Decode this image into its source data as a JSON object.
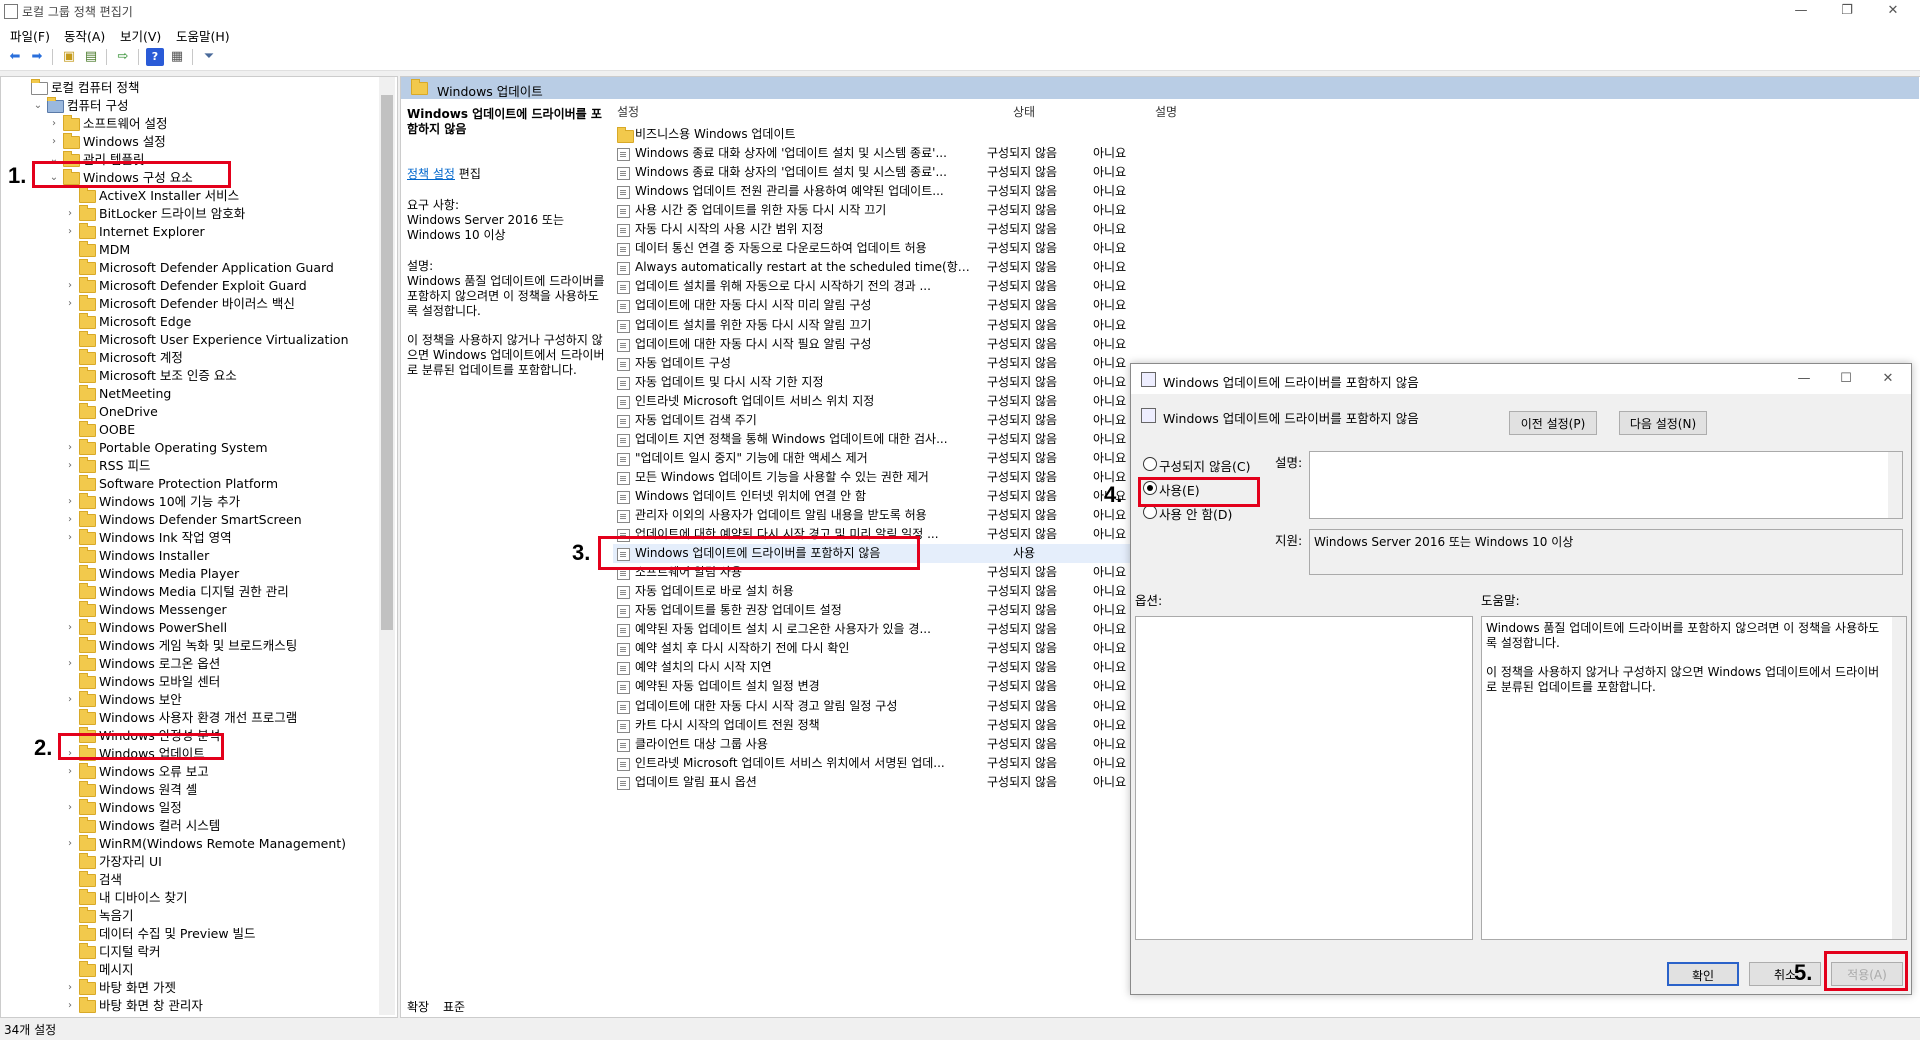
{
  "window": {
    "title": "로컬 그룹 정책 편집기"
  },
  "menu": [
    "파일(F)",
    "동작(A)",
    "보기(V)",
    "도움말(H)"
  ],
  "tree": {
    "items": [
      {
        "label": "로컬 컴퓨터 정책"
      },
      {
        "label": "컴퓨터 구성"
      },
      {
        "label": "소프트웨어 설정"
      },
      {
        "label": "Windows 설정"
      },
      {
        "label": "관리 템플릿"
      },
      {
        "label": "Windows 구성 요소"
      },
      {
        "label": "ActiveX Installer 서비스"
      },
      {
        "label": "BitLocker 드라이브 암호화"
      },
      {
        "label": "Internet Explorer"
      },
      {
        "label": "MDM"
      },
      {
        "label": "Microsoft Defender Application Guard"
      },
      {
        "label": "Microsoft Defender Exploit Guard"
      },
      {
        "label": "Microsoft Defender 바이러스 백신"
      },
      {
        "label": "Microsoft Edge"
      },
      {
        "label": "Microsoft User Experience Virtualization"
      },
      {
        "label": "Microsoft 계정"
      },
      {
        "label": "Microsoft 보조 인증 요소"
      },
      {
        "label": "NetMeeting"
      },
      {
        "label": "OneDrive"
      },
      {
        "label": "OOBE"
      },
      {
        "label": "Portable Operating System"
      },
      {
        "label": "RSS 피드"
      },
      {
        "label": "Software Protection Platform"
      },
      {
        "label": "Windows 10에 기능 추가"
      },
      {
        "label": "Windows Defender SmartScreen"
      },
      {
        "label": "Windows Ink 작업 영역"
      },
      {
        "label": "Windows Installer"
      },
      {
        "label": "Windows Media Player"
      },
      {
        "label": "Windows Media 디지털 권한 관리"
      },
      {
        "label": "Windows Messenger"
      },
      {
        "label": "Windows PowerShell"
      },
      {
        "label": "Windows 게임 녹화 및 브로드캐스팅"
      },
      {
        "label": "Windows 로그온 옵션"
      },
      {
        "label": "Windows 모바일 센터"
      },
      {
        "label": "Windows 보안"
      },
      {
        "label": "Windows 사용자 환경 개선 프로그램"
      },
      {
        "label": "Windows 안정성 분석"
      },
      {
        "label": "Windows 업데이트"
      },
      {
        "label": "Windows 오류 보고"
      },
      {
        "label": "Windows 원격 셸"
      },
      {
        "label": "Windows 일정"
      },
      {
        "label": "Windows 컬러 시스템"
      },
      {
        "label": "WinRM(Windows Remote Management)"
      },
      {
        "label": "가장자리 UI"
      },
      {
        "label": "검색"
      },
      {
        "label": "내 디바이스 찾기"
      },
      {
        "label": "녹음기"
      },
      {
        "label": "데이터 수집 및 Preview 빌드"
      },
      {
        "label": "디지털 락커"
      },
      {
        "label": "메시지"
      },
      {
        "label": "바탕 화면 가젯"
      },
      {
        "label": "바탕 화면 창 관리자"
      }
    ]
  },
  "right": {
    "header": "Windows 업데이트",
    "desc": {
      "title": "Windows 업데이트에 드라이버를 포함하지 않음",
      "edit_link": "정책 설정",
      "edit_suffix": " 편집",
      "req_label": "요구 사항:",
      "req_text": "Windows Server 2016 또는 Windows 10 이상",
      "desc_label": "설명:",
      "desc_p1": "Windows 품질 업데이트에 드라이버를 포함하지 않으려면 이 정책을 사용하도록 설정합니다.",
      "desc_p2": "이 정책을 사용하지 않거나 구성하지 않으면 Windows 업데이트에서 드라이버로 분류된 업데이트를 포함합니다."
    },
    "columns": {
      "setting": "설정",
      "state": "상태",
      "comment": "설명"
    },
    "rows": [
      {
        "name": "비즈니스용 Windows 업데이트",
        "state": "",
        "comment": "",
        "folder": true
      },
      {
        "name": "Windows 종료 대화 상자에 '업데이트 설치 및 시스템 종료'...",
        "state": "구성되지 않음",
        "comment": "아니요"
      },
      {
        "name": "Windows 종료 대화 상자의 '업데이트 설치 및 시스템 종료'...",
        "state": "구성되지 않음",
        "comment": "아니요"
      },
      {
        "name": "Windows 업데이트 전원 관리를 사용하여 예약된 업데이트...",
        "state": "구성되지 않음",
        "comment": "아니요"
      },
      {
        "name": "사용 시간 중 업데이트를 위한 자동 다시 시작 끄기",
        "state": "구성되지 않음",
        "comment": "아니요"
      },
      {
        "name": "자동 다시 시작의 사용 시간 범위 지정",
        "state": "구성되지 않음",
        "comment": "아니요"
      },
      {
        "name": "데이터 통신 연결 중 자동으로 다운로드하여 업데이트 허용",
        "state": "구성되지 않음",
        "comment": "아니요"
      },
      {
        "name": "Always automatically restart at the scheduled time(항상 예...",
        "state": "구성되지 않음",
        "comment": "아니요"
      },
      {
        "name": "업데이트 설치를 위해 자동으로 다시 시작하기 전의 경과 ...",
        "state": "구성되지 않음",
        "comment": "아니요"
      },
      {
        "name": "업데이트에 대한 자동 다시 시작 미리 알림 구성",
        "state": "구성되지 않음",
        "comment": "아니요"
      },
      {
        "name": "업데이트 설치를 위한 자동 다시 시작 알림 끄기",
        "state": "구성되지 않음",
        "comment": "아니요"
      },
      {
        "name": "업데이트에 대한 자동 다시 시작 필요 알림 구성",
        "state": "구성되지 않음",
        "comment": "아니요"
      },
      {
        "name": "자동 업데이트 구성",
        "state": "구성되지 않음",
        "comment": "아니요"
      },
      {
        "name": "자동 업데이트 및 다시 시작 기한 지정",
        "state": "구성되지 않음",
        "comment": "아니요"
      },
      {
        "name": "인트라넷 Microsoft 업데이트 서비스 위치 지정",
        "state": "구성되지 않음",
        "comment": "아니요"
      },
      {
        "name": "자동 업데이트 검색 주기",
        "state": "구성되지 않음",
        "comment": "아니요"
      },
      {
        "name": "업데이트 지연 정책을 통해 Windows 업데이트에 대한 검사...",
        "state": "구성되지 않음",
        "comment": "아니요"
      },
      {
        "name": "\"업데이트 일시 중지\" 기능에 대한 액세스 제거",
        "state": "구성되지 않음",
        "comment": "아니요"
      },
      {
        "name": "모든 Windows 업데이트 기능을 사용할 수 있는 권한 제거",
        "state": "구성되지 않음",
        "comment": "아니요"
      },
      {
        "name": "Windows 업데이트 인터넷 위치에 연결 안 함",
        "state": "구성되지 않음",
        "comment": "아니요"
      },
      {
        "name": "관리자 이외의 사용자가 업데이트 알림 내용을 받도록 허용",
        "state": "구성되지 않음",
        "comment": "아니요"
      },
      {
        "name": "업데이트에 대한 예약된 다시 시작 경고 및 미리 알림 일정 ...",
        "state": "구성되지 않음",
        "comment": "아니요"
      },
      {
        "name": "Windows 업데이트에 드라이버를 포함하지 않음",
        "state": "사용",
        "comment": "아니요"
      },
      {
        "name": "소프트웨어 알림 사용",
        "state": "구성되지 않음",
        "comment": "아니요"
      },
      {
        "name": "자동 업데이트로 바로 설치 허용",
        "state": "구성되지 않음",
        "comment": "아니요"
      },
      {
        "name": "자동 업데이트를 통한 권장 업데이트 설정",
        "state": "구성되지 않음",
        "comment": "아니요"
      },
      {
        "name": "예약된 자동 업데이트 설치 시 로그온한 사용자가 있을 경...",
        "state": "구성되지 않음",
        "comment": "아니요"
      },
      {
        "name": "예약 설치 후 다시 시작하기 전에 다시 확인",
        "state": "구성되지 않음",
        "comment": "아니요"
      },
      {
        "name": "예약 설치의 다시 시작 지연",
        "state": "구성되지 않음",
        "comment": "아니요"
      },
      {
        "name": "예약된 자동 업데이트 설치 일정 변경",
        "state": "구성되지 않음",
        "comment": "아니요"
      },
      {
        "name": "업데이트에 대한 자동 다시 시작 경고 알림 일정 구성",
        "state": "구성되지 않음",
        "comment": "아니요"
      },
      {
        "name": "카트 다시 시작의 업데이트 전원 정책",
        "state": "구성되지 않음",
        "comment": "아니요"
      },
      {
        "name": "클라이언트 대상 그룹 사용",
        "state": "구성되지 않음",
        "comment": "아니요"
      },
      {
        "name": "인트라넷 Microsoft 업데이트 서비스 위치에서 서명된 업데...",
        "state": "구성되지 않음",
        "comment": "아니요"
      },
      {
        "name": "업데이트 알림 표시 옵션",
        "state": "구성되지 않음",
        "comment": "아니요"
      }
    ],
    "tabs": [
      "확장",
      "표준"
    ]
  },
  "status": "34개 설정",
  "dialog": {
    "title": "Windows 업데이트에 드라이버를 포함하지 않음",
    "subtitle": "Windows 업데이트에 드라이버를 포함하지 않음",
    "prev_btn": "이전 설정(P)",
    "next_btn": "다음 설정(N)",
    "radio_not_configured": "구성되지 않음(C)",
    "radio_enabled": "사용(E)",
    "radio_disabled": "사용 안 함(D)",
    "comment_label": "설명:",
    "supported_label": "지원:",
    "supported_text": "Windows Server 2016 또는 Windows 10 이상",
    "options_label": "옵션:",
    "help_label": "도움말:",
    "help_p1": "Windows 품질 업데이트에 드라이버를 포함하지 않으려면 이 정책을 사용하도록 설정합니다.",
    "help_p2": "이 정책을 사용하지 않거나 구성하지 않으면 Windows 업데이트에서 드라이버로 분류된 업데이트를 포함합니다.",
    "ok": "확인",
    "cancel": "취소",
    "apply": "적용(A)"
  },
  "annotations": [
    "1.",
    "2.",
    "3.",
    "4.",
    "5."
  ],
  "colors": {
    "highlight": "#e3001b",
    "header": "#b9cde5",
    "folder": "#f2c94c"
  }
}
